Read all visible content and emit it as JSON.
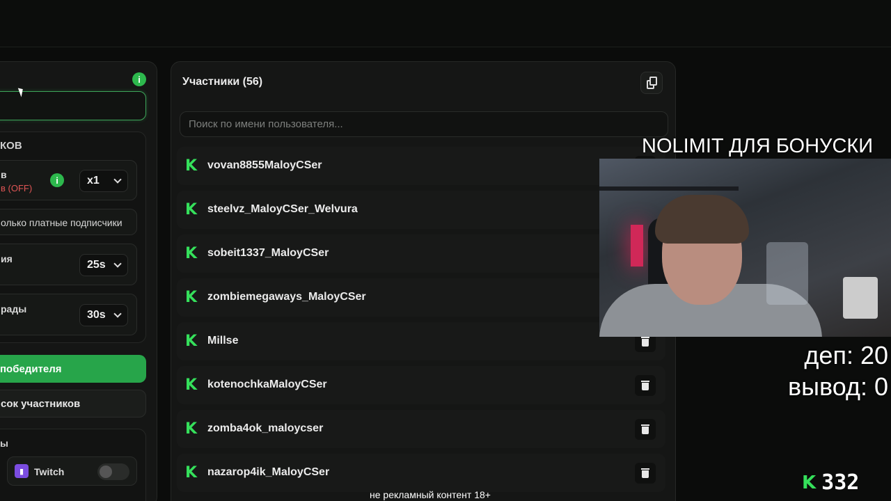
{
  "left_panel": {
    "section_title": "КОВ",
    "multiplier_row": {
      "label": "в",
      "status": "в (OFF)",
      "info": "i",
      "value": "x1"
    },
    "subscribers_row": {
      "label": "олько платные подписчики"
    },
    "timer_row_1": {
      "label": "ия",
      "value": "25s"
    },
    "timer_row_2": {
      "label": "рады",
      "value": "30s"
    },
    "pick_winner_button": "победителя",
    "participants_list_button": "сок участников",
    "platforms_title": "ы",
    "twitch": {
      "label": "Twitch",
      "icon": "twitch-icon"
    },
    "info": "i"
  },
  "participants": {
    "title": "Участники (56)",
    "search_placeholder": "Поиск по имени пользователя...",
    "users": [
      "vovan8855MaloyCSer",
      "steelvz_MaloyCSer_Welvura",
      "sobeit1337_MaloyCSer",
      "zombiemegaways_MaloyCSer",
      "Millse",
      "kotenochkaMaloyCSer",
      "zomba4ok_maloycser",
      "nazarop4ik_MaloyCSer"
    ],
    "platform_icon": "K"
  },
  "overlay": {
    "title": "NOLIMIT ДЛЯ БОНУСКИ",
    "deposit": "деп: 20",
    "withdraw": "вывод: 0",
    "balance_icon": "K",
    "balance": "332",
    "disclaimer": "не рекламный контент 18+"
  },
  "colors": {
    "accent": "#27a54a",
    "kick_green": "#35e05b",
    "panel_bg": "#151615",
    "page_bg": "#0b0c0b"
  }
}
